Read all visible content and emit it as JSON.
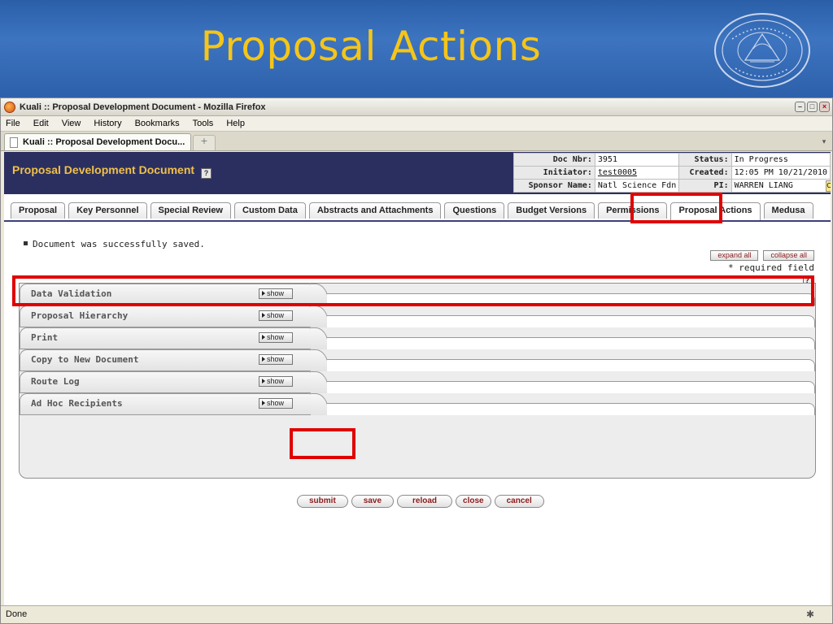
{
  "slide": {
    "title": "Proposal Actions"
  },
  "window": {
    "title": "Kuali :: Proposal Development Document - Mozilla Firefox",
    "menu": [
      "File",
      "Edit",
      "View",
      "History",
      "Bookmarks",
      "Tools",
      "Help"
    ],
    "tab_title": "Kuali :: Proposal Development Docu...",
    "new_tab": "+",
    "status": "Done"
  },
  "doc": {
    "title": "Proposal Development Document",
    "help": "?",
    "doc_nbr_label": "Doc Nbr:",
    "doc_nbr": "3951",
    "status_label": "Status:",
    "status": "In Progress",
    "initiator_label": "Initiator:",
    "initiator": "test0005",
    "created_label": "Created:",
    "created": "12:05 PM 10/21/2010",
    "sponsor_label": "Sponsor Name:",
    "sponsor": "Natl Science Fdn",
    "pi_label": "PI:",
    "pi": "WARREN LIANG",
    "corner": "C"
  },
  "tabs": [
    "Proposal",
    "Key Personnel",
    "Special Review",
    "Custom Data",
    "Abstracts and Attachments",
    "Questions",
    "Budget Versions",
    "Permissions",
    "Proposal Actions",
    "Medusa"
  ],
  "message": "Document was successfully saved.",
  "controls": {
    "expand_all": "expand all",
    "collapse_all": "collapse all",
    "required": "* required field",
    "help": "?"
  },
  "sections": [
    {
      "label": "Data Validation",
      "button": "show"
    },
    {
      "label": "Proposal Hierarchy",
      "button": "show"
    },
    {
      "label": "Print",
      "button": "show"
    },
    {
      "label": "Copy to New Document",
      "button": "show"
    },
    {
      "label": "Route Log",
      "button": "show"
    },
    {
      "label": "Ad Hoc Recipients",
      "button": "show"
    }
  ],
  "actions": {
    "submit": "submit",
    "save": "save",
    "reload": "reload",
    "close": "close",
    "cancel": "cancel"
  },
  "colors": {
    "highlight": "#e00000",
    "title": "#f5c518",
    "header": "#2b2f60"
  }
}
